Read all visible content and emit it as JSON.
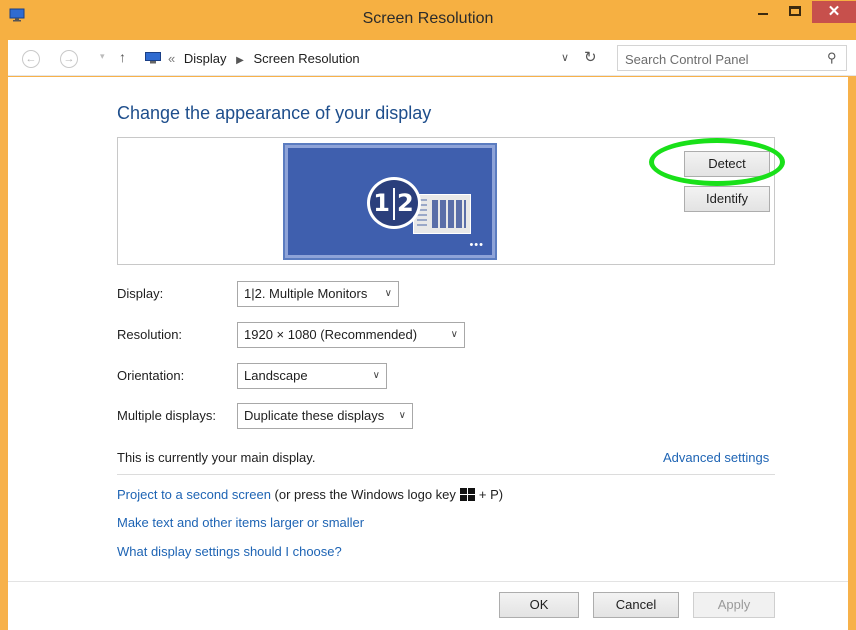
{
  "window": {
    "title": "Screen Resolution",
    "controls": {
      "minimize_icon": "minimize-icon",
      "maximize_icon": "maximize-icon",
      "close_icon": "close-icon",
      "close_glyph": "✕"
    }
  },
  "addressbar": {
    "crumb_lead": "«",
    "crumbs": [
      "Display",
      "Screen Resolution"
    ],
    "search_placeholder": "Search Control Panel"
  },
  "main": {
    "heading": "Change the appearance of your display",
    "preview": {
      "badge_left": "1",
      "badge_right": "2",
      "detect_label": "Detect",
      "identify_label": "Identify"
    },
    "settings": {
      "display_label": "Display:",
      "display_value": "1|2. Multiple Monitors",
      "resolution_label": "Resolution:",
      "resolution_value": "1920 × 1080 (Recommended)",
      "orientation_label": "Orientation:",
      "orientation_value": "Landscape",
      "multiple_label": "Multiple displays:",
      "multiple_value": "Duplicate these displays"
    },
    "main_display_note": "This is currently your main display.",
    "advanced_link": "Advanced settings",
    "project_link": "Project to a second screen",
    "project_note_before": "(or press the Windows logo key",
    "project_note_after": "+ P)",
    "larger_link": "Make text and other items larger or smaller",
    "settings_link": "What display settings should I choose?"
  },
  "footer": {
    "ok_label": "OK",
    "cancel_label": "Cancel",
    "apply_label": "Apply"
  },
  "colors": {
    "titlebar": "#f6b042",
    "link": "#1e64b4",
    "heading": "#1e4e8c",
    "highlight_ring": "#19e019"
  }
}
